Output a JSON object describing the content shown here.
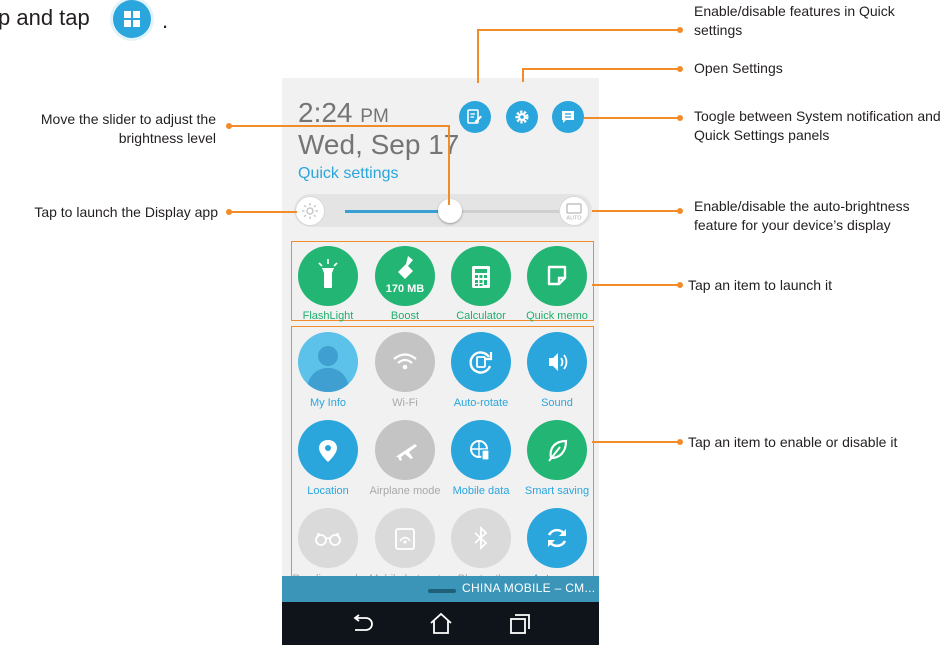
{
  "intro": {
    "text": "p and tap",
    "suffix": "."
  },
  "phone": {
    "time": "2:24",
    "ampm": "PM",
    "date": "Wed, Sep 17",
    "quick_settings_label": "Quick settings",
    "status_bar": "CHINA MOBILE – CM...",
    "apps": [
      {
        "label": "FlashLight",
        "icon": "flashlight-icon"
      },
      {
        "label": "Boost",
        "icon": "broom-icon",
        "badge": "170 MB"
      },
      {
        "label": "Calculator",
        "icon": "calculator-icon"
      },
      {
        "label": "Quick memo",
        "icon": "memo-icon"
      }
    ],
    "toggles": [
      {
        "label": "My Info",
        "icon": "avatar-icon"
      },
      {
        "label": "Wi-Fi",
        "icon": "wifi-icon"
      },
      {
        "label": "Auto-rotate",
        "icon": "rotate-icon"
      },
      {
        "label": "Sound",
        "icon": "sound-icon"
      },
      {
        "label": "Location",
        "icon": "location-icon"
      },
      {
        "label": "Airplane mode",
        "icon": "airplane-icon"
      },
      {
        "label": "Mobile data",
        "icon": "mobile-data-icon"
      },
      {
        "label": "Smart saving",
        "icon": "leaf-icon"
      },
      {
        "label": "Reading mode",
        "icon": "glasses-icon"
      },
      {
        "label": "Mobile hotspot",
        "icon": "hotspot-icon"
      },
      {
        "label": "Bluetooth",
        "icon": "bluetooth-icon"
      },
      {
        "label": "Auto-sync",
        "icon": "sync-icon"
      }
    ],
    "brightness_level": 0.45
  },
  "callouts": {
    "features": "Enable/disable features in Quick settings",
    "settings": "Open Settings",
    "toggle_panels": "Toogle between System notification and Quick Settings panels",
    "slider": "Move the slider to adjust the brightness level",
    "display_app": "Tap to launch the Display app",
    "auto_brightness": "Enable/disable the auto-brightness feature for your device’s display",
    "launch_item": "Tap an item to launch it",
    "enable_item": "Tap an item to enable or disable it"
  },
  "colors": {
    "accent_blue": "#2aa6dd",
    "app_green": "#22b573",
    "callout_orange": "#f28c28"
  }
}
